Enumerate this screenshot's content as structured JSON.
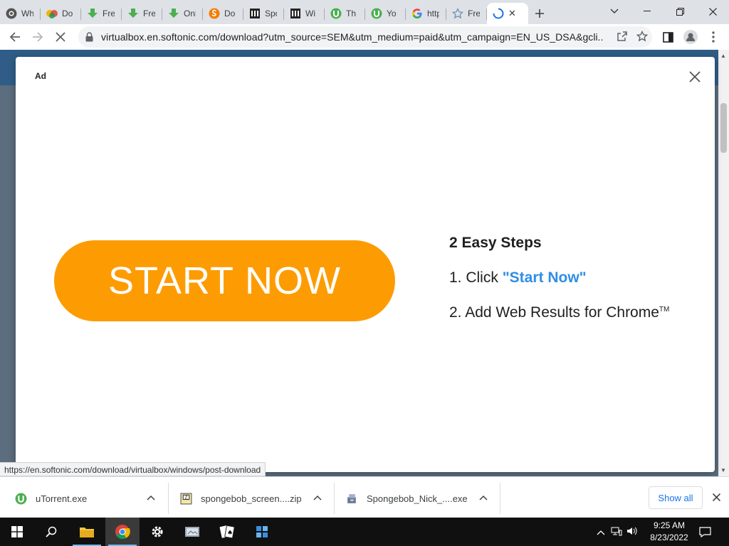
{
  "browser": {
    "tabs": [
      {
        "title": "Wh",
        "icon": "github-icon"
      },
      {
        "title": "Do",
        "icon": "colorful-drive-icon"
      },
      {
        "title": "Fre",
        "icon": "download-arrow-icon"
      },
      {
        "title": "Fre",
        "icon": "download-arrow-icon"
      },
      {
        "title": "Onl",
        "icon": "download-arrow-icon"
      },
      {
        "title": "Do",
        "icon": "orange-s-icon"
      },
      {
        "title": "Spo",
        "icon": "archive-building-icon"
      },
      {
        "title": "Wi",
        "icon": "archive-building-icon"
      },
      {
        "title": "Th",
        "icon": "utorrent-icon"
      },
      {
        "title": "Yo",
        "icon": "utorrent-icon"
      },
      {
        "title": "http",
        "icon": "google-icon"
      },
      {
        "title": "Fre",
        "icon": "star-outline-icon"
      }
    ],
    "active_tab": {
      "icon": "loading-spinner-icon"
    },
    "address": "virtualbox.en.softonic.com/download?utm_source=SEM&utm_medium=paid&utm_campaign=EN_US_DSA&gcli..."
  },
  "ad": {
    "label": "Ad",
    "start_label": "START NOW",
    "steps_title": "2 Easy Steps",
    "step1_prefix": "1. Click ",
    "step1_highlight": "\"Start Now\"",
    "step2_text": "2. Add Web Results for Chrome",
    "step2_mark": "TM"
  },
  "status_bar": {
    "url": "https://en.softonic.com/download/virtualbox/windows/post-download"
  },
  "downloads": {
    "items": [
      {
        "name": "uTorrent.exe",
        "icon": "utorrent-icon"
      },
      {
        "name": "spongebob_screen....zip",
        "icon": "zip-archive-icon"
      },
      {
        "name": "Spongebob_Nick_....exe",
        "icon": "installer-icon"
      }
    ],
    "show_all_label": "Show all"
  },
  "taskbar": {
    "time": "9:25 AM",
    "date": "8/23/2022"
  },
  "colors": {
    "start_button": "#fd9c02",
    "highlight": "#2f8ee5"
  }
}
